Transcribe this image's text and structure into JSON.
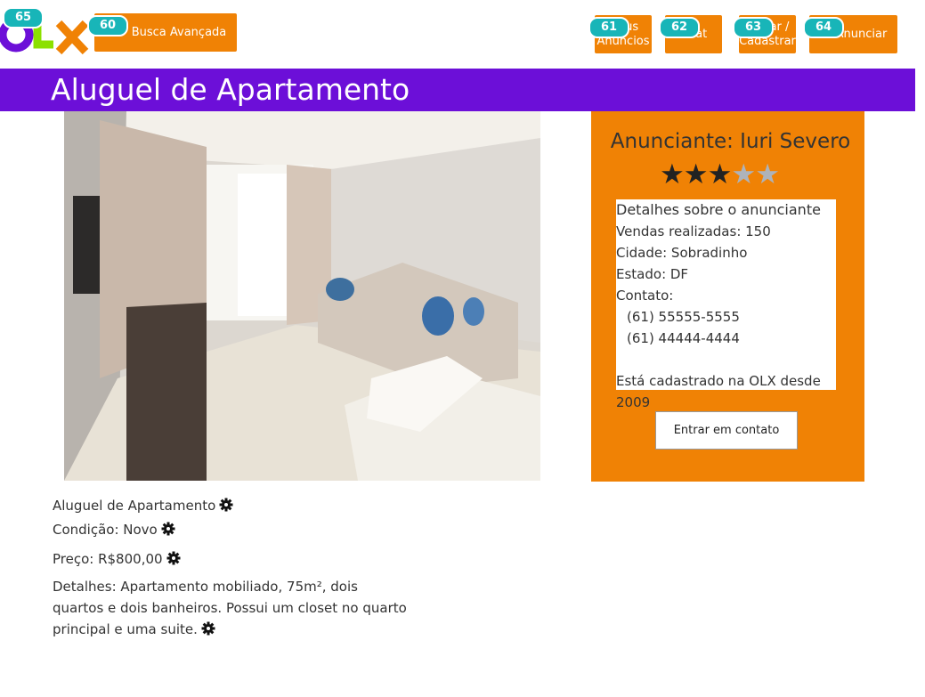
{
  "header": {
    "logo_text": "OLX",
    "buttons": {
      "advanced_search": "Busca Avançada",
      "my_ads": "Meus Anúncios",
      "chat": "Chat",
      "login": "Entrar / Cadastrar",
      "publish": "Anunciar"
    },
    "badges": {
      "logo": "65",
      "advanced_search": "60",
      "my_ads": "61",
      "chat": "62",
      "login": "63",
      "publish": "64"
    }
  },
  "page": {
    "title": "Aluguel de Apartamento"
  },
  "seller": {
    "name": "Anunciante: Iuri Severo",
    "rating": 3,
    "rating_max": 5,
    "details_heading": "Detalhes sobre o anunciante",
    "sales": "Vendas realizadas: 150",
    "city": "Cidade: Sobradinho",
    "state": "Estado: DF",
    "contact_label": "Contato:",
    "phone_1": "(61) 55555-5555",
    "phone_2": "(61) 44444-4444",
    "member_since": "Está cadastrado na OLX desde 2009",
    "contact_button": "Entrar em contato"
  },
  "listing": {
    "title": "Aluguel de Apartamento",
    "condition": "Condição: Novo",
    "price": "Preço: R$800,00",
    "details": "Detalhes: Apartamento mobiliado, 75m², dois quartos e dois banheiros. Possui um closet no quarto principal e uma suite."
  },
  "colors": {
    "brand_purple": "#6c0fd8",
    "brand_orange": "#f08205",
    "badge_teal": "#18b5b8"
  }
}
